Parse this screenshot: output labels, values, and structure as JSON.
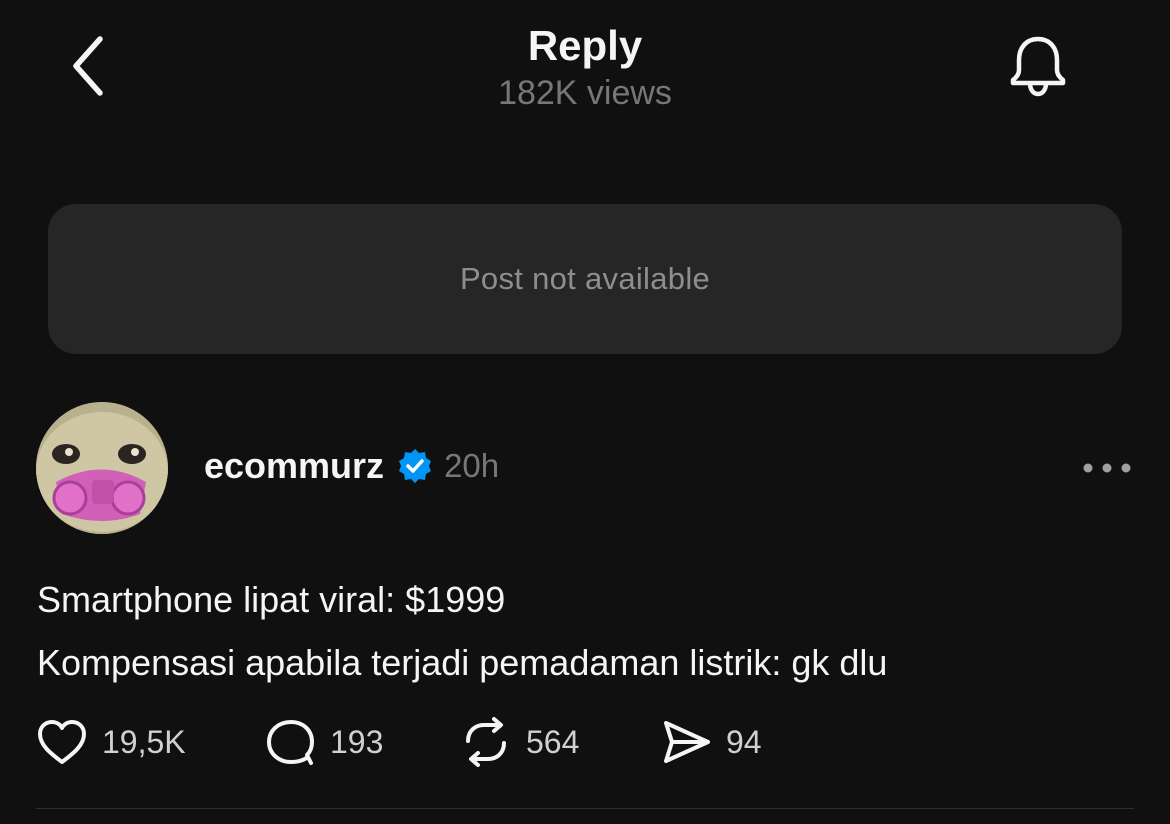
{
  "header": {
    "title": "Reply",
    "views": "182K views",
    "back_icon": "chevron-left-icon",
    "bell_icon": "bell-icon"
  },
  "parent_post": {
    "message": "Post not available"
  },
  "post": {
    "username": "ecommurz",
    "verified": true,
    "time": "20h",
    "lines": [
      "Smartphone lipat viral: $1999",
      "Kompensasi apabila terjadi pemadaman listrik: gk dlu"
    ],
    "actions": {
      "likes": "19,5K",
      "comments": "193",
      "reposts": "564",
      "shares": "94"
    }
  },
  "colors": {
    "background": "#101010",
    "card": "#262626",
    "text": "#f3f5f7",
    "muted": "#777777",
    "verified_blue": "#0095f6"
  }
}
